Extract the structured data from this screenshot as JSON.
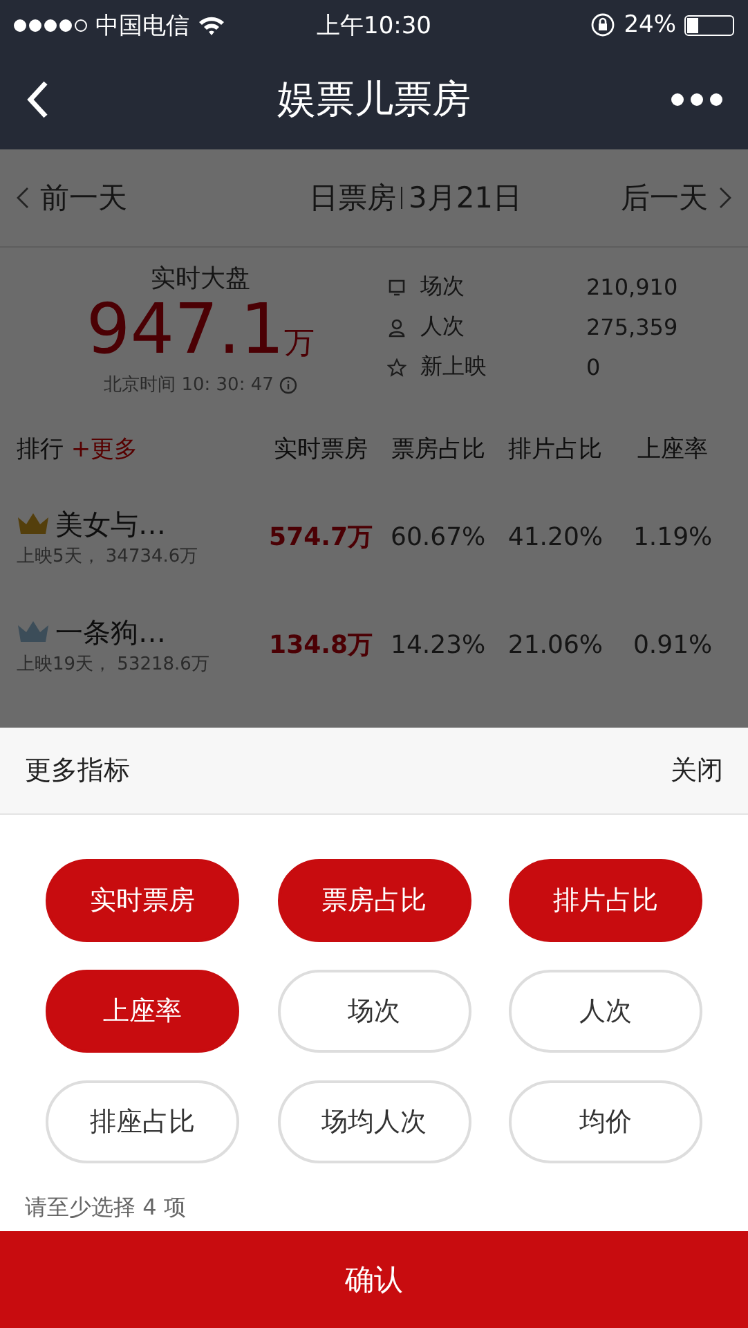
{
  "status_bar": {
    "carrier": "中国电信",
    "time": "上午10:30",
    "battery_text": "24%"
  },
  "nav": {
    "title": "娱票儿票房"
  },
  "date_bar": {
    "prev": "前一天",
    "mode": "日票房",
    "date": "3月21日",
    "next": "后一天"
  },
  "summary": {
    "label": "实时大盘",
    "value": "947.1",
    "unit": "万",
    "time": "北京时间 10: 30: 47",
    "stats": [
      {
        "kind": "screenings",
        "label": "场次",
        "value": "210,910"
      },
      {
        "kind": "audience",
        "label": "人次",
        "value": "275,359"
      },
      {
        "kind": "new",
        "label": "新上映",
        "value": "0"
      }
    ]
  },
  "ranking": {
    "title": "排行",
    "more": "+更多",
    "columns": [
      "实时票房",
      "票房占比",
      "排片占比",
      "上座率"
    ],
    "rows": [
      {
        "kind": "gold",
        "name": "美女与…",
        "sub": "上映5天， 34734.6万",
        "cells": [
          "574.7万",
          "60.67%",
          "41.20%",
          "1.19%"
        ]
      },
      {
        "kind": "silver",
        "name": "一条狗…",
        "sub": "上映19天， 53218.6万",
        "cells": [
          "134.8万",
          "14.23%",
          "21.06%",
          "0.91%"
        ]
      }
    ]
  },
  "sheet": {
    "title": "更多指标",
    "close": "关闭",
    "options": [
      {
        "label": "实时票房",
        "selected": true
      },
      {
        "label": "票房占比",
        "selected": true
      },
      {
        "label": "排片占比",
        "selected": true
      },
      {
        "label": "上座率",
        "selected": true
      },
      {
        "label": "场次",
        "selected": false
      },
      {
        "label": "人次",
        "selected": false
      },
      {
        "label": "排座占比",
        "selected": false
      },
      {
        "label": "场均人次",
        "selected": false
      },
      {
        "label": "均价",
        "selected": false
      }
    ],
    "hint": "请至少选择 4 项",
    "confirm": "确认"
  }
}
